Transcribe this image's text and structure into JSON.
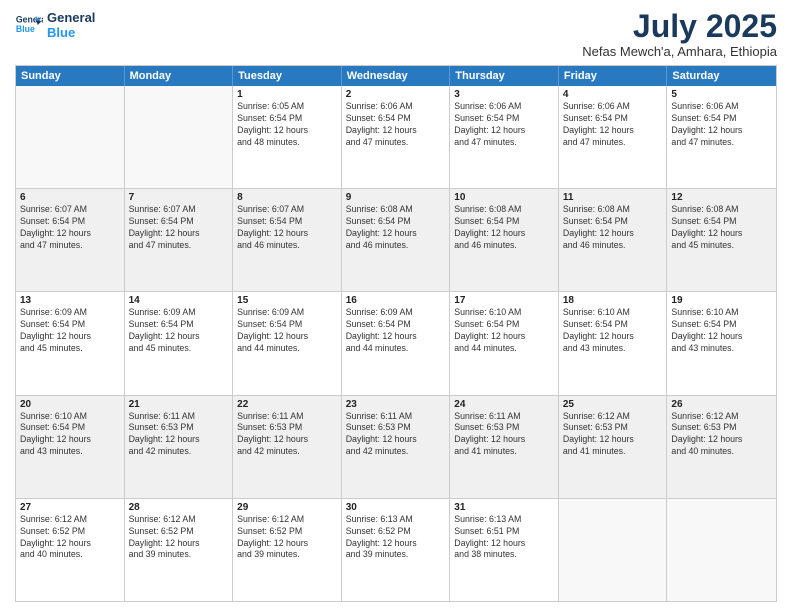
{
  "logo": {
    "line1": "General",
    "line2": "Blue"
  },
  "title": "July 2025",
  "subtitle": "Nefas Mewch'a, Amhara, Ethiopia",
  "days": [
    "Sunday",
    "Monday",
    "Tuesday",
    "Wednesday",
    "Thursday",
    "Friday",
    "Saturday"
  ],
  "rows": [
    [
      {
        "day": "",
        "info": ""
      },
      {
        "day": "",
        "info": ""
      },
      {
        "day": "1",
        "info": "Sunrise: 6:05 AM\nSunset: 6:54 PM\nDaylight: 12 hours\nand 48 minutes."
      },
      {
        "day": "2",
        "info": "Sunrise: 6:06 AM\nSunset: 6:54 PM\nDaylight: 12 hours\nand 47 minutes."
      },
      {
        "day": "3",
        "info": "Sunrise: 6:06 AM\nSunset: 6:54 PM\nDaylight: 12 hours\nand 47 minutes."
      },
      {
        "day": "4",
        "info": "Sunrise: 6:06 AM\nSunset: 6:54 PM\nDaylight: 12 hours\nand 47 minutes."
      },
      {
        "day": "5",
        "info": "Sunrise: 6:06 AM\nSunset: 6:54 PM\nDaylight: 12 hours\nand 47 minutes."
      }
    ],
    [
      {
        "day": "6",
        "info": "Sunrise: 6:07 AM\nSunset: 6:54 PM\nDaylight: 12 hours\nand 47 minutes."
      },
      {
        "day": "7",
        "info": "Sunrise: 6:07 AM\nSunset: 6:54 PM\nDaylight: 12 hours\nand 47 minutes."
      },
      {
        "day": "8",
        "info": "Sunrise: 6:07 AM\nSunset: 6:54 PM\nDaylight: 12 hours\nand 46 minutes."
      },
      {
        "day": "9",
        "info": "Sunrise: 6:08 AM\nSunset: 6:54 PM\nDaylight: 12 hours\nand 46 minutes."
      },
      {
        "day": "10",
        "info": "Sunrise: 6:08 AM\nSunset: 6:54 PM\nDaylight: 12 hours\nand 46 minutes."
      },
      {
        "day": "11",
        "info": "Sunrise: 6:08 AM\nSunset: 6:54 PM\nDaylight: 12 hours\nand 46 minutes."
      },
      {
        "day": "12",
        "info": "Sunrise: 6:08 AM\nSunset: 6:54 PM\nDaylight: 12 hours\nand 45 minutes."
      }
    ],
    [
      {
        "day": "13",
        "info": "Sunrise: 6:09 AM\nSunset: 6:54 PM\nDaylight: 12 hours\nand 45 minutes."
      },
      {
        "day": "14",
        "info": "Sunrise: 6:09 AM\nSunset: 6:54 PM\nDaylight: 12 hours\nand 45 minutes."
      },
      {
        "day": "15",
        "info": "Sunrise: 6:09 AM\nSunset: 6:54 PM\nDaylight: 12 hours\nand 44 minutes."
      },
      {
        "day": "16",
        "info": "Sunrise: 6:09 AM\nSunset: 6:54 PM\nDaylight: 12 hours\nand 44 minutes."
      },
      {
        "day": "17",
        "info": "Sunrise: 6:10 AM\nSunset: 6:54 PM\nDaylight: 12 hours\nand 44 minutes."
      },
      {
        "day": "18",
        "info": "Sunrise: 6:10 AM\nSunset: 6:54 PM\nDaylight: 12 hours\nand 43 minutes."
      },
      {
        "day": "19",
        "info": "Sunrise: 6:10 AM\nSunset: 6:54 PM\nDaylight: 12 hours\nand 43 minutes."
      }
    ],
    [
      {
        "day": "20",
        "info": "Sunrise: 6:10 AM\nSunset: 6:54 PM\nDaylight: 12 hours\nand 43 minutes."
      },
      {
        "day": "21",
        "info": "Sunrise: 6:11 AM\nSunset: 6:53 PM\nDaylight: 12 hours\nand 42 minutes."
      },
      {
        "day": "22",
        "info": "Sunrise: 6:11 AM\nSunset: 6:53 PM\nDaylight: 12 hours\nand 42 minutes."
      },
      {
        "day": "23",
        "info": "Sunrise: 6:11 AM\nSunset: 6:53 PM\nDaylight: 12 hours\nand 42 minutes."
      },
      {
        "day": "24",
        "info": "Sunrise: 6:11 AM\nSunset: 6:53 PM\nDaylight: 12 hours\nand 41 minutes."
      },
      {
        "day": "25",
        "info": "Sunrise: 6:12 AM\nSunset: 6:53 PM\nDaylight: 12 hours\nand 41 minutes."
      },
      {
        "day": "26",
        "info": "Sunrise: 6:12 AM\nSunset: 6:53 PM\nDaylight: 12 hours\nand 40 minutes."
      }
    ],
    [
      {
        "day": "27",
        "info": "Sunrise: 6:12 AM\nSunset: 6:52 PM\nDaylight: 12 hours\nand 40 minutes."
      },
      {
        "day": "28",
        "info": "Sunrise: 6:12 AM\nSunset: 6:52 PM\nDaylight: 12 hours\nand 39 minutes."
      },
      {
        "day": "29",
        "info": "Sunrise: 6:12 AM\nSunset: 6:52 PM\nDaylight: 12 hours\nand 39 minutes."
      },
      {
        "day": "30",
        "info": "Sunrise: 6:13 AM\nSunset: 6:52 PM\nDaylight: 12 hours\nand 39 minutes."
      },
      {
        "day": "31",
        "info": "Sunrise: 6:13 AM\nSunset: 6:51 PM\nDaylight: 12 hours\nand 38 minutes."
      },
      {
        "day": "",
        "info": ""
      },
      {
        "day": "",
        "info": ""
      }
    ]
  ]
}
